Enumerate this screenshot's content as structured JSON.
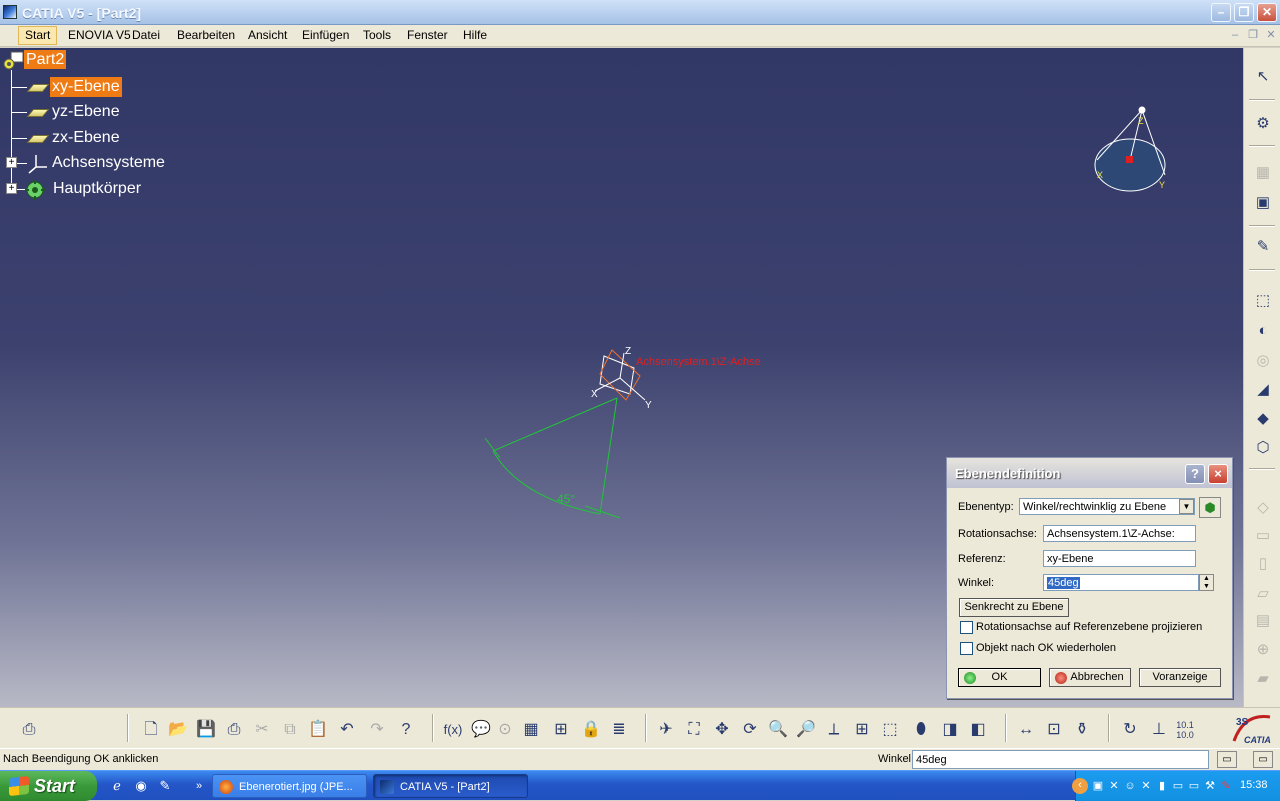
{
  "window": {
    "title": "CATIA V5 - [Part2]"
  },
  "menu": {
    "items": [
      "Start",
      "ENOVIA V5",
      "Datei",
      "Bearbeiten",
      "Ansicht",
      "Einfügen",
      "Tools",
      "Fenster",
      "Hilfe"
    ]
  },
  "tree": {
    "root": "Part2",
    "items": [
      "xy-Ebene",
      "yz-Ebene",
      "zx-Ebene",
      "Achsensysteme",
      "Hauptkörper"
    ],
    "selected": "xy-Ebene"
  },
  "viewport": {
    "angle_label": "45°",
    "axis_x": "X",
    "axis_y": "Y",
    "axis_z": "Z",
    "compass_x": "X",
    "compass_y": "Y",
    "compass_z": "Z",
    "sketch_label": "Achsensystem.1\\Z-Achse"
  },
  "dialog": {
    "title": "Ebenendefinition",
    "help_label": "?",
    "close_label": "×",
    "type_label": "Ebenentyp:",
    "type_value": "Winkel/rechtwinklig zu Ebene",
    "rotation_label": "Rotationsachse:",
    "rotation_value": "Achsensystem.1\\Z-Achse:",
    "reference_label": "Referenz:",
    "reference_value": "xy-Ebene",
    "angle_label": "Winkel:",
    "angle_value": "45deg",
    "perpendicular_button": "Senkrecht zu Ebene",
    "checkbox_project": "Rotationsachse auf Referenzebene projizieren",
    "checkbox_repeat": "Objekt nach OK wiederholen",
    "ok_button": "OK",
    "cancel_button": "Abbrechen",
    "preview_button": "Voranzeige"
  },
  "toolbar": {
    "formula_label": "f(x)",
    "ratio_top": "10.1",
    "ratio_bottom": "10.0",
    "catia_logo": "CATIA"
  },
  "status": {
    "message": "Nach Beendigung OK anklicken",
    "param_label": "Winkel",
    "param_value": "45deg"
  },
  "taskbar": {
    "start_label": "Start",
    "tasks": [
      "Ebenerotiert.jpg (JPE...",
      "CATIA V5 - [Part2]"
    ],
    "clock": "15:38"
  },
  "colors": {
    "selection": "#ef7b14",
    "sketch_green": "#22c43a",
    "viewport_top": "#323866",
    "viewport_bottom": "#b8b9c6"
  }
}
